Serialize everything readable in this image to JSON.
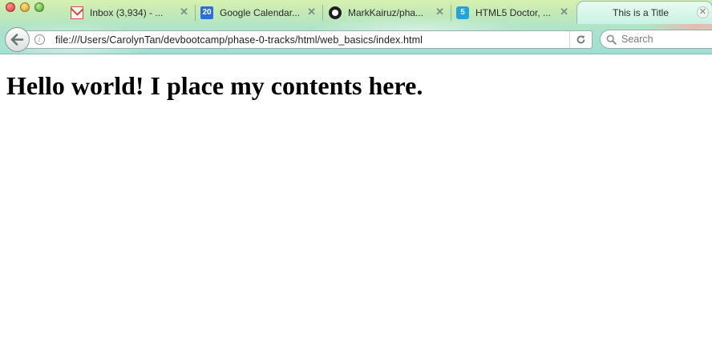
{
  "window": {
    "traffic_lights": [
      "close",
      "minimize",
      "zoom"
    ]
  },
  "tabs": [
    {
      "label": "Inbox (3,934) - ...",
      "icon": "gmail-icon",
      "active": false
    },
    {
      "label": "Google Calendar...",
      "icon": "calendar-icon",
      "icon_text": "20",
      "active": false
    },
    {
      "label": "MarkKairuz/pha...",
      "icon": "github-icon",
      "active": false
    },
    {
      "label": "HTML5 Doctor, ...",
      "icon": "html5-doctor-icon",
      "icon_text": "5",
      "active": false
    },
    {
      "label": "This is a Title",
      "icon": null,
      "active": true
    }
  ],
  "toolbar": {
    "url": "file:///Users/CarolynTan/devbootcamp/phase-0-tracks/html/web_basics/index.html",
    "search_placeholder": "Search"
  },
  "page": {
    "heading": "Hello world! I place my contents here."
  },
  "colors": {
    "chrome_gradient_top": "#d7f0b0",
    "chrome_gradient_bottom": "#9edfd3",
    "active_tab": "#c8f2e3",
    "content_background": "#ffffff"
  }
}
